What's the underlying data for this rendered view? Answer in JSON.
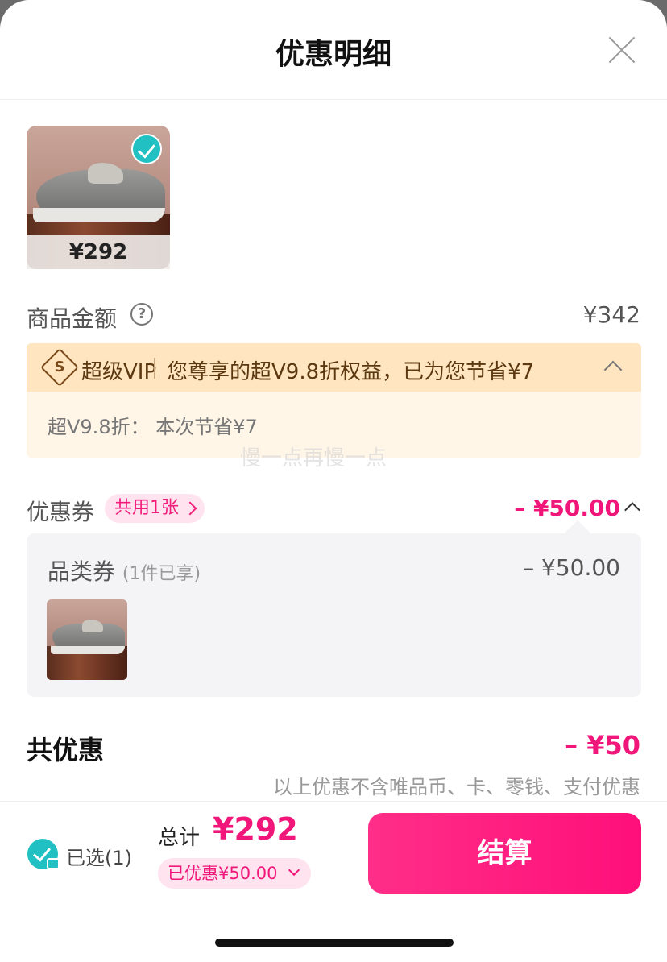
{
  "header": {
    "title": "优惠明细"
  },
  "product": {
    "price": "¥292"
  },
  "goods_amount": {
    "label": "商品金额",
    "help_icon": "question-circle-icon",
    "value": "¥342"
  },
  "vip": {
    "icon": "super-vip-s-icon",
    "name": "超级VIP",
    "description": "您尊享的超V9.8折权益，已为您节省¥7",
    "detail": "超V9.8折：  本次节省¥7"
  },
  "watermark": "慢一点再慢一点",
  "coupon": {
    "label": "优惠券",
    "tag": "共用1张",
    "total": "– ¥50.00",
    "category": "品类券",
    "category_note": "(1件已享)",
    "category_value": "– ¥50.00"
  },
  "discount_total": {
    "label": "共优惠",
    "value": "– ¥50",
    "note": "以上优惠不含唯品币、卡、零钱、支付优惠"
  },
  "footer": {
    "selected": "已选(1)",
    "sum_label": "总计",
    "sum_value": "¥292",
    "discount_pill": "已优惠¥50.00",
    "pay_button": "结算"
  },
  "colors": {
    "accent_pink": "#f0167a",
    "check_teal": "#21c1c3",
    "vip_bg": "#ffe6c0"
  }
}
